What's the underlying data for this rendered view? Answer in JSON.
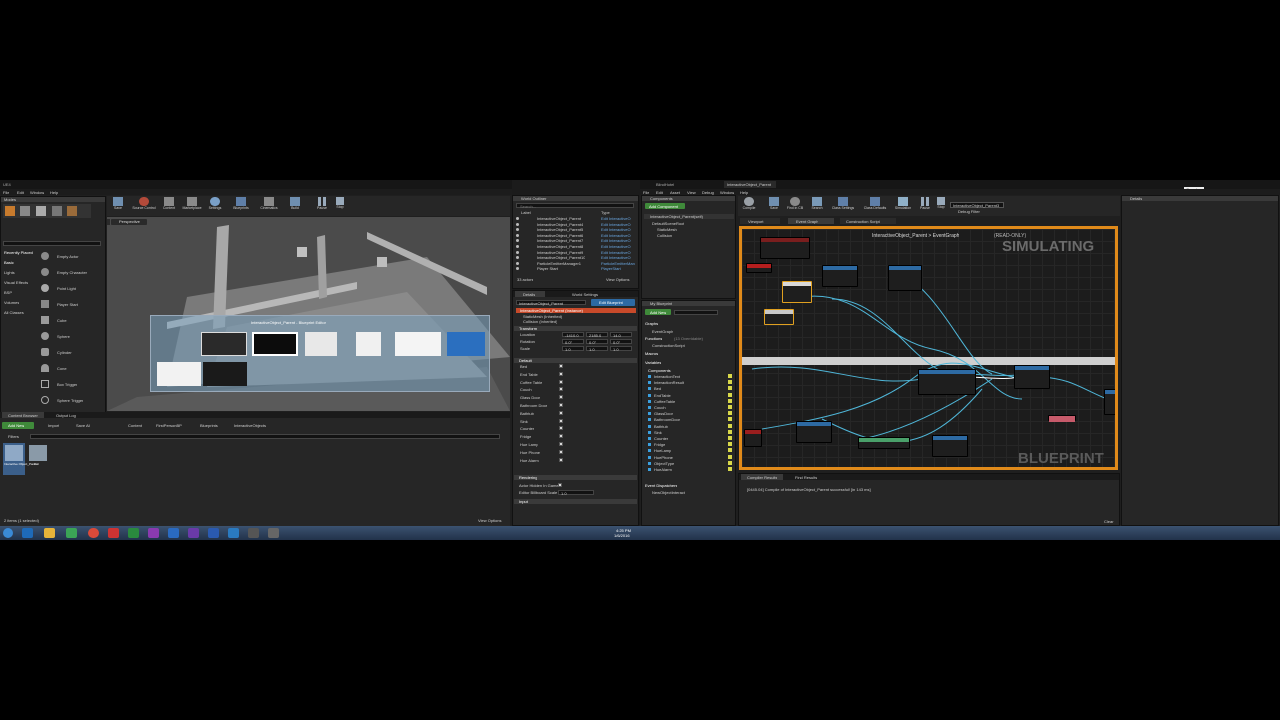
{
  "left_editor": {
    "title": "UE4",
    "project": "BlindHotel",
    "menu": [
      "File",
      "Edit",
      "Window",
      "Help"
    ],
    "modes_title": "Modes",
    "search_label": "Google",
    "categories": [
      "Recently Placed",
      "Basic",
      "Lights",
      "Visual Effects",
      "BSP",
      "Volumes",
      "All Classes"
    ],
    "placeables": [
      "Empty Actor",
      "Empty Character",
      "Point Light",
      "Player Start",
      "Cube",
      "Sphere",
      "Cylinder",
      "Cone",
      "Box Trigger",
      "Sphere Trigger"
    ],
    "toolbar": [
      "Save",
      "Source Control",
      "Content",
      "Marketplace",
      "Settings",
      "Blueprints",
      "Cinematics",
      "Build",
      "Pause",
      "Stop"
    ],
    "viewport_label": "Perspective",
    "alt_tab_title": "InteractiveObject_Parent - Blueprint Editor",
    "content_tabs": [
      "Content Browser",
      "Output Log"
    ],
    "content_buttons": {
      "add_new": "Add New",
      "import": "Import",
      "save_all": "Save All"
    },
    "breadcrumb": [
      "Content",
      "FirstPersonBP",
      "Blueprints",
      "InteractiveObjects"
    ],
    "filters": "Filters",
    "assets": [
      "Interactive Object_Parent",
      "Bed"
    ],
    "items_status": "2 items (1 selected)",
    "view_options": "View Options"
  },
  "outliner": {
    "title": "World Outliner",
    "search_placeholder": "Search...",
    "col_label": "Label",
    "col_type": "Type",
    "rows": [
      {
        "label": "InteractiveObject_Parent",
        "type": "Edit InteractiveO"
      },
      {
        "label": "InteractiveObject_Parent4",
        "type": "Edit InteractiveO"
      },
      {
        "label": "InteractiveObject_Parent5",
        "type": "Edit InteractiveO"
      },
      {
        "label": "InteractiveObject_Parent6",
        "type": "Edit InteractiveO"
      },
      {
        "label": "InteractiveObject_Parent7",
        "type": "Edit InteractiveO"
      },
      {
        "label": "InteractiveObject_Parent8",
        "type": "Edit InteractiveO"
      },
      {
        "label": "InteractiveObject_Parent9",
        "type": "Edit InteractiveO"
      },
      {
        "label": "InteractiveObject_Parent10",
        "type": "Edit InteractiveO"
      },
      {
        "label": "ParticleEmitterManager1",
        "type": "ParticleEmitterMan"
      },
      {
        "label": "Player Start",
        "type": "PlayerStart"
      }
    ],
    "actor_count": "33 actors",
    "view_options": "View Options"
  },
  "details": {
    "tabs": [
      "Details",
      "World Settings"
    ],
    "name_value": "InteractiveObject_Parent",
    "edit_blueprint": "Edit Blueprint",
    "components": [
      "InteractiveObject_Parent (Instance)",
      "StaticMesh (Inherited)",
      "Collision (Inherited)"
    ],
    "transform_title": "Transform",
    "transform_rows": [
      {
        "label": "Location",
        "x": "-1410.0",
        "y": "2185.0",
        "z": "14.0"
      },
      {
        "label": "Rotation",
        "x": "0.0°",
        "y": "0.0°",
        "z": "0.0°"
      },
      {
        "label": "Scale",
        "x": "1.0",
        "y": "1.0",
        "z": "1.0"
      }
    ],
    "default_title": "Default",
    "bools": [
      "Bed",
      "End Table",
      "Coffee Table",
      "Couch",
      "Glass Door",
      "Bathroom Door",
      "Bathtub",
      "Sink",
      "Counter",
      "Fridge",
      "Hue Lamp",
      "Hue Phone",
      "Hue Alarm"
    ],
    "rendering_title": "Rendering",
    "rendering_rows": [
      "Actor Hidden In Game",
      "Editor Billboard Scale"
    ],
    "billboard_scale": "1.0",
    "input_title": "Input"
  },
  "bp_editor": {
    "title": "BlindHotel",
    "window_title": "InteractiveObject_Parent",
    "menu": [
      "File",
      "Edit",
      "Asset",
      "View",
      "Debug",
      "Window",
      "Help"
    ],
    "parent_class": "Parent class: Actor",
    "search_label": "Google",
    "components_title": "Components",
    "add_component": "Add Component",
    "components_tree": [
      "InteractiveObject_Parent(self)",
      "DefaultSceneRoot",
      "StaticMesh",
      "Collision"
    ],
    "toolbar": [
      "Compile",
      "Save",
      "Find in CB",
      "Search",
      "Class Settings",
      "Class Defaults",
      "Simulation",
      "Pause",
      "Stop"
    ],
    "debug_object": "InteractiveObject_Parent3",
    "debug_filter": "Debug Filter",
    "tabs": [
      "Viewport",
      "Event Graph",
      "Construction Script"
    ],
    "graph_title": "InteractiveObject_Parent > EventGraph",
    "graph_readonly": "(READ-ONLY)",
    "simulating": "SIMULATING",
    "watermark": "BLUEPRINT",
    "my_blueprint_title": "My Blueprint",
    "add_new": "Add New",
    "sections": [
      "Graphs",
      "Functions",
      "Macros",
      "Variables",
      "Event Dispatchers"
    ],
    "graphs": [
      "EventGraph"
    ],
    "functions": [
      "ConstructionScript"
    ],
    "functions_count": "(13 Overridable)",
    "variables_group": "Components",
    "variables": [
      "InteractionText",
      "InteractionResult",
      "Bed",
      "EndTable",
      "CoffeeTable",
      "Couch",
      "GlassDoor",
      "BathroomDoor",
      "Bathtub",
      "Sink",
      "Counter",
      "Fridge",
      "HueLamp",
      "HuePhone",
      "ObjectType",
      "HueAlarm"
    ],
    "event_dispatchers": [
      "NewObjectInteract"
    ],
    "compiler_tabs": [
      "Compiler Results",
      "Find Results"
    ],
    "compiler_log": "[0445.04] Compile of InteractiveObject_Parent successful! [in 143 ms]",
    "clear": "Clear",
    "details_title": "Details"
  },
  "taskbar": {
    "time": "4:25 PM",
    "date": "1/6/2016"
  },
  "colors": {
    "accent": "#2d6aa3",
    "simulating_border": "#e08a1a",
    "wire": "#4fb6d8",
    "selection": "#3f6fa6"
  }
}
